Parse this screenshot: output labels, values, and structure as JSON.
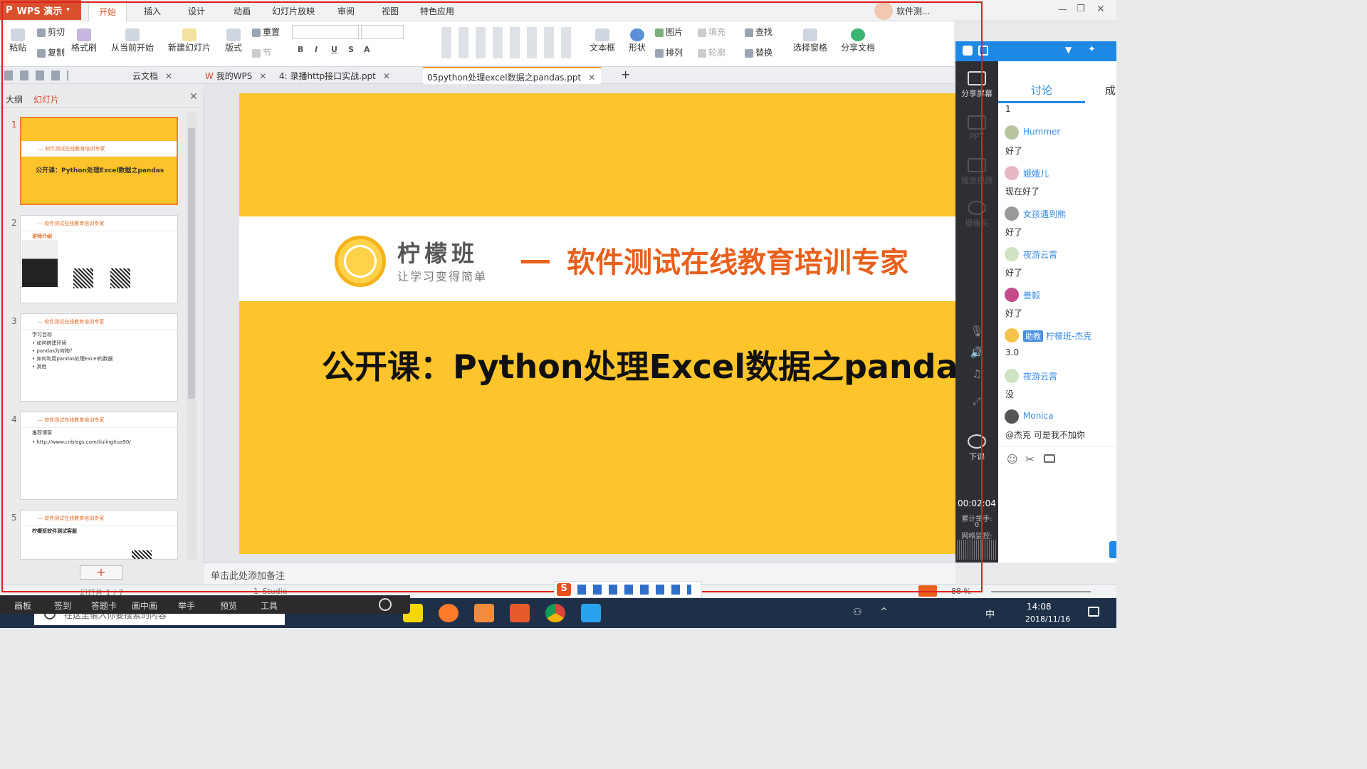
{
  "app": {
    "name": "WPS 演示",
    "accent": "#d9502d"
  },
  "menu_tabs": [
    "开始",
    "插入",
    "设计",
    "动画",
    "幻灯片放映",
    "审阅",
    "视图",
    "特色应用"
  ],
  "user": {
    "name": "软件测..."
  },
  "ribbon": {
    "paste": "粘贴",
    "cut": "剪切",
    "copy": "复制",
    "format_painter": "格式刷",
    "from_current": "从当前开始",
    "new_slide": "新建幻灯片",
    "layout": "版式",
    "reset": "重置",
    "section": "节",
    "picture": "图片",
    "fill": "填充",
    "text_box": "文本框",
    "shape": "形状",
    "arrange": "排列",
    "outline": "轮廓",
    "find": "查找",
    "replace": "替换",
    "select_pane": "选择窗格",
    "share_doc": "分享文档"
  },
  "doc_tabs": [
    {
      "label": "云文档",
      "active": false
    },
    {
      "label": "我的WPS",
      "active": false
    },
    {
      "label": "4: 录播http接口实战.ppt",
      "active": false
    },
    {
      "label": "05python处理excel数据之pandas.ppt",
      "active": true
    }
  ],
  "left_pane": {
    "tab_outline": "大纲",
    "tab_slides": "幻灯片",
    "slides": [
      {
        "num": "1",
        "header": "— 软件测试在线教育培训专家",
        "title": "公开课：Python处理Excel数据之pandas"
      },
      {
        "num": "2",
        "header": "— 软件测试在线教育培训专家",
        "title": "讲师介绍"
      },
      {
        "num": "3",
        "header": "— 软件测试在线教育培训专家",
        "title": "学习目标",
        "bullets": [
          "如何搭建环境",
          "pandas为何物？",
          "如何利用pandas处理Excel的数据",
          "其他"
        ]
      },
      {
        "num": "4",
        "header": "— 软件测试在线教育培训专家",
        "title": "推荐博客",
        "bullets": [
          "http://www.cnblogs.com/liulinghua90/"
        ]
      },
      {
        "num": "5",
        "header": "— 软件测试在线教育培训专家",
        "title": "柠檬班软件测试客服"
      }
    ]
  },
  "slide": {
    "brand": "柠檬班",
    "brand_sub": "让学习变得简单",
    "slogan": "软件测试在线教育培训专家",
    "title": "公开课：Python处理Excel数据之panda"
  },
  "notes_placeholder": "单击此处添加备注",
  "status": {
    "slide_of": "幻灯片 1 / 7",
    "theme": "1_Studio",
    "zoom": "88 %"
  },
  "classroom": {
    "controls": [
      "分享屏幕",
      "PPT",
      "播放视频",
      "摄像头",
      "下课"
    ],
    "timer": "00:02:04",
    "hands_label": "累计举手:",
    "hands_count": "0",
    "network_label": "网络监控:",
    "chat_tabs": [
      "讨论",
      "成"
    ],
    "first_line": "1",
    "messages": [
      {
        "name": "Hummer",
        "text": "好了"
      },
      {
        "name": "娥娥儿",
        "text": "现在好了"
      },
      {
        "name": "女孩遇到熊",
        "text": "好了"
      },
      {
        "name": "夜游云霄",
        "text": "好了"
      },
      {
        "name": "善毅",
        "text": "好了"
      },
      {
        "name": "柠檬班-杰克",
        "badge": "助教",
        "text": "3.0"
      },
      {
        "name": "夜游云霄",
        "text": "没"
      },
      {
        "name": "Monica",
        "text": "@杰克 可是我不加你"
      }
    ],
    "toolbar": [
      "画板",
      "签到",
      "答题卡",
      "画中画",
      "举手",
      "预览",
      "工具"
    ]
  },
  "taskbar": {
    "time": "14:08",
    "date": "2018/11/16",
    "ime": "中",
    "search_placeholder": "在这里输入你要搜索的内容"
  }
}
